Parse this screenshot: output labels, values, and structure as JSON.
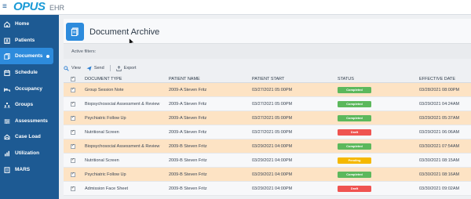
{
  "app": {
    "logo_main": "OPUS",
    "logo_sub": "EHR",
    "menu_glyph": "≡"
  },
  "sidebar": {
    "items": [
      {
        "label": "Home",
        "icon": "home-icon",
        "active": false
      },
      {
        "label": "Patients",
        "icon": "patients-icon",
        "active": false
      },
      {
        "label": "Documents",
        "icon": "documents-icon",
        "active": true
      },
      {
        "label": "Schedule",
        "icon": "schedule-icon",
        "active": false
      },
      {
        "label": "Occupancy",
        "icon": "occupancy-icon",
        "active": false
      },
      {
        "label": "Groups",
        "icon": "groups-icon",
        "active": false
      },
      {
        "label": "Assessments",
        "icon": "assessments-icon",
        "active": false
      },
      {
        "label": "Case Load",
        "icon": "case-load-icon",
        "active": false
      },
      {
        "label": "Utilization",
        "icon": "utilization-icon",
        "active": false
      },
      {
        "label": "MARS",
        "icon": "mars-icon",
        "active": false
      }
    ]
  },
  "page": {
    "title": "Document Archive",
    "filters_label": "Active filters:"
  },
  "toolbar": {
    "view_label": "View",
    "send_label": "Send",
    "export_label": "Export"
  },
  "table": {
    "headers": {
      "type": "DOCUMENT TYPE",
      "name": "PATIENT NAME",
      "start": "PATIENT START",
      "status": "STATUS",
      "date": "EFFECTIVE DATE"
    },
    "rows": [
      {
        "type": "Group Session Note",
        "name": "2009-A Steven Fritz",
        "start": "03/27/2021 05:00PM",
        "status": "Completed",
        "date": "03/28/2021 08:00PM",
        "highlight": true
      },
      {
        "type": "Biopsychosocial Assessment & Review",
        "name": "2009-A Steven Fritz",
        "start": "03/27/2021 05:00PM",
        "status": "Completed",
        "date": "03/29/2021 04:24AM",
        "highlight": false
      },
      {
        "type": "Psychiatric Follow Up",
        "name": "2009-A Steven Fritz",
        "start": "03/27/2021 05:00PM",
        "status": "Completed",
        "date": "03/29/2021 05:37AM",
        "highlight": true
      },
      {
        "type": "Nutritional Screen",
        "name": "2009-A Steven Fritz",
        "start": "03/27/2021 05:00PM",
        "status": "Draft",
        "date": "03/29/2021 06:06AM",
        "highlight": false
      },
      {
        "type": "Biopsychosocial Assessment & Review",
        "name": "2009-B Steven Fritz",
        "start": "03/29/2021 04:00PM",
        "status": "Completed",
        "date": "03/30/2021 07:54AM",
        "highlight": true
      },
      {
        "type": "Nutritional Screen",
        "name": "2009-B Steven Fritz",
        "start": "03/29/2021 04:00PM",
        "status": "Pending",
        "date": "03/30/2021 08:15AM",
        "highlight": false
      },
      {
        "type": "Psychiatric Follow Up",
        "name": "2009-B Steven Fritz",
        "start": "03/29/2021 04:00PM",
        "status": "Completed",
        "date": "03/30/2021 08:16AM",
        "highlight": true
      },
      {
        "type": "Admission Face Sheet",
        "name": "2009-B Steven Fritz",
        "start": "03/29/2021 04:00PM",
        "status": "Draft",
        "date": "03/30/2021 09:02AM",
        "highlight": false
      }
    ]
  },
  "colors": {
    "sidebar_bg": "#1d5a93",
    "accent": "#2d8bdc",
    "completed": "#5cb85c",
    "draft": "#ef5350",
    "pending": "#f5b800",
    "row_highlight": "#fde3c4"
  }
}
